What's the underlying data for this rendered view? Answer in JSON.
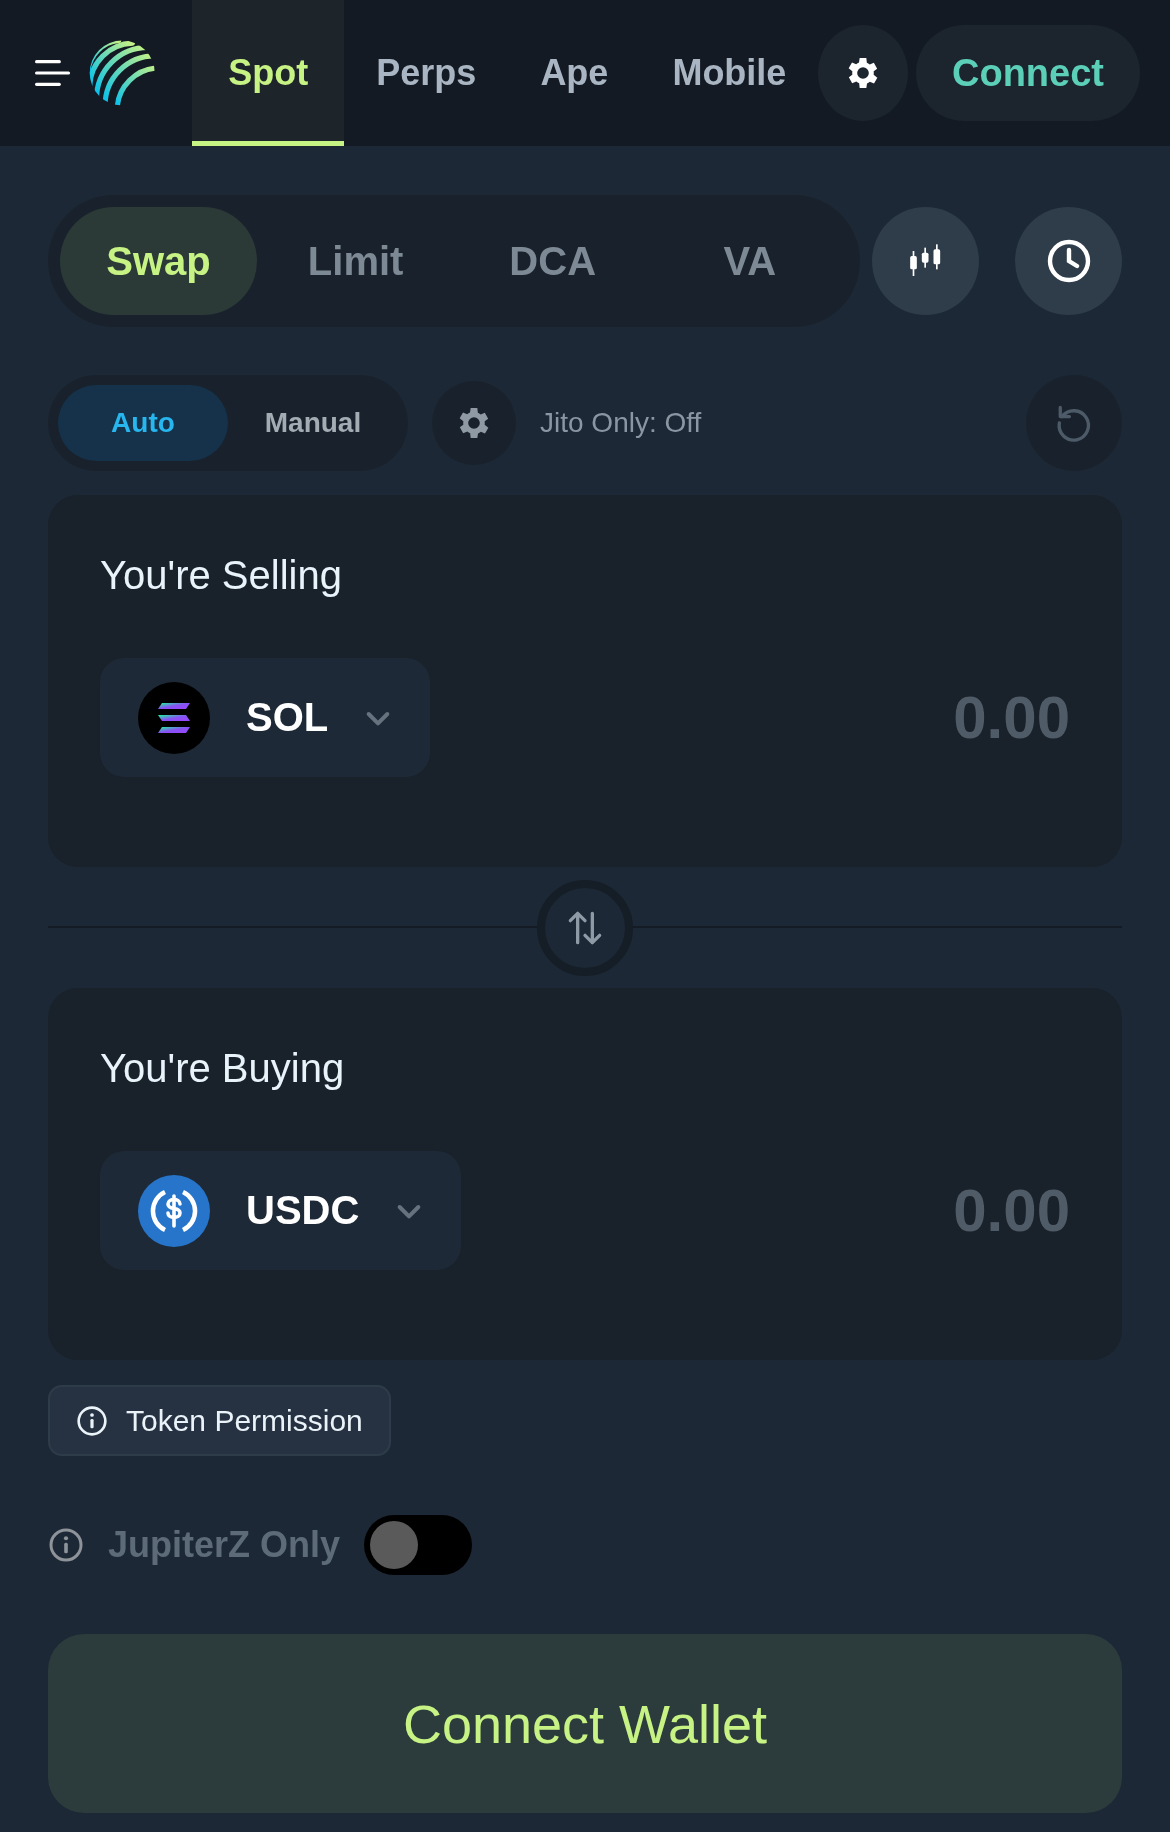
{
  "header": {
    "nav_tabs": [
      {
        "label": "Spot",
        "selected": true
      },
      {
        "label": "Perps",
        "selected": false
      },
      {
        "label": "Ape",
        "selected": false
      },
      {
        "label": "Mobile",
        "selected": false
      }
    ],
    "connect_button": "Connect"
  },
  "mode_tabs": [
    {
      "label": "Swap",
      "selected": true
    },
    {
      "label": "Limit",
      "selected": false
    },
    {
      "label": "DCA",
      "selected": false
    },
    {
      "label": "VA",
      "selected": false
    }
  ],
  "routing": {
    "options": [
      {
        "label": "Auto",
        "selected": true
      },
      {
        "label": "Manual",
        "selected": false
      }
    ],
    "jito_status": "Jito Only: Off"
  },
  "selling": {
    "title": "You're Selling",
    "token": "SOL",
    "placeholder": "0.00"
  },
  "buying": {
    "title": "You're Buying",
    "token": "USDC",
    "placeholder": "0.00"
  },
  "token_permission": "Token Permission",
  "jupiterz": {
    "label": "JupiterZ Only",
    "on": false
  },
  "connect_wallet": "Connect Wallet"
}
